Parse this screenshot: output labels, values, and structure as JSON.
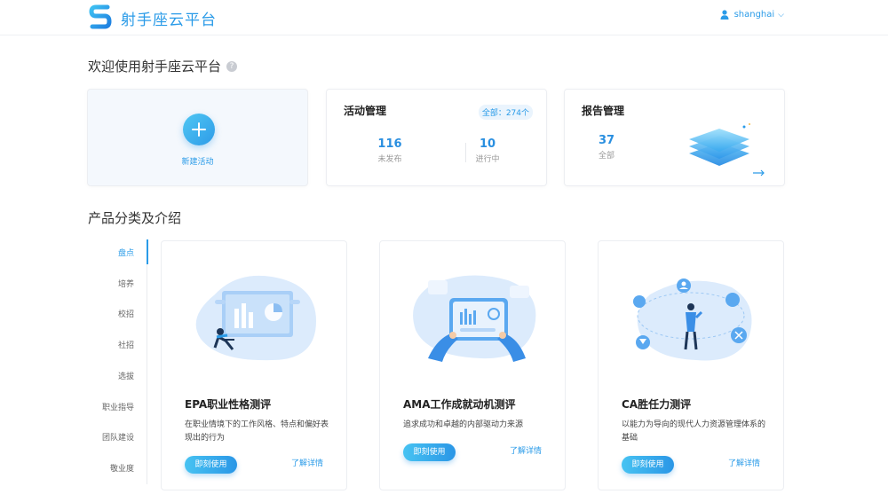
{
  "header": {
    "logo_text": "射手座云平台",
    "user_name": "shanghai",
    "user_chevron": "⌵"
  },
  "welcome": {
    "title": "欢迎使用射手座云平台",
    "help": "?"
  },
  "new_activity": {
    "label": "新建活动"
  },
  "activity": {
    "title": "活动管理",
    "total": "全部：274个",
    "stats": [
      {
        "value": "116",
        "label": "未发布"
      },
      {
        "value": "10",
        "label": "进行中"
      }
    ]
  },
  "report": {
    "title": "报告管理",
    "value": "37",
    "label": "全部"
  },
  "products_section": {
    "title": "产品分类及介绍"
  },
  "nav": {
    "items": [
      {
        "label": "盘点"
      },
      {
        "label": "培养"
      },
      {
        "label": "校招"
      },
      {
        "label": "社招"
      },
      {
        "label": "选拔"
      },
      {
        "label": "职业指导"
      },
      {
        "label": "团队建设"
      },
      {
        "label": "敬业度"
      }
    ]
  },
  "products": [
    {
      "name": "EPA职业性格测评",
      "desc": "在职业情境下的工作风格、特点和偏好表现出的行为",
      "use_label": "即刻使用",
      "detail_label": "了解详情"
    },
    {
      "name": "AMA工作成就动机测评",
      "desc": "追求成功和卓越的内部驱动力来源",
      "use_label": "即刻使用",
      "detail_label": "了解详情"
    },
    {
      "name": "CA胜任力测评",
      "desc": "以能力为导向的现代人力资源管理体系的基础",
      "use_label": "即刻使用",
      "detail_label": "了解详情"
    }
  ],
  "colors": {
    "accent": "#2a9be8",
    "accent_light": "#eaf4fd",
    "text_dark": "#222222",
    "text_muted": "#999999"
  },
  "icons": {
    "logo": "s-logo-icon",
    "user": "user-icon",
    "plus": "plus-icon",
    "arrow": "arrow-right-icon"
  }
}
